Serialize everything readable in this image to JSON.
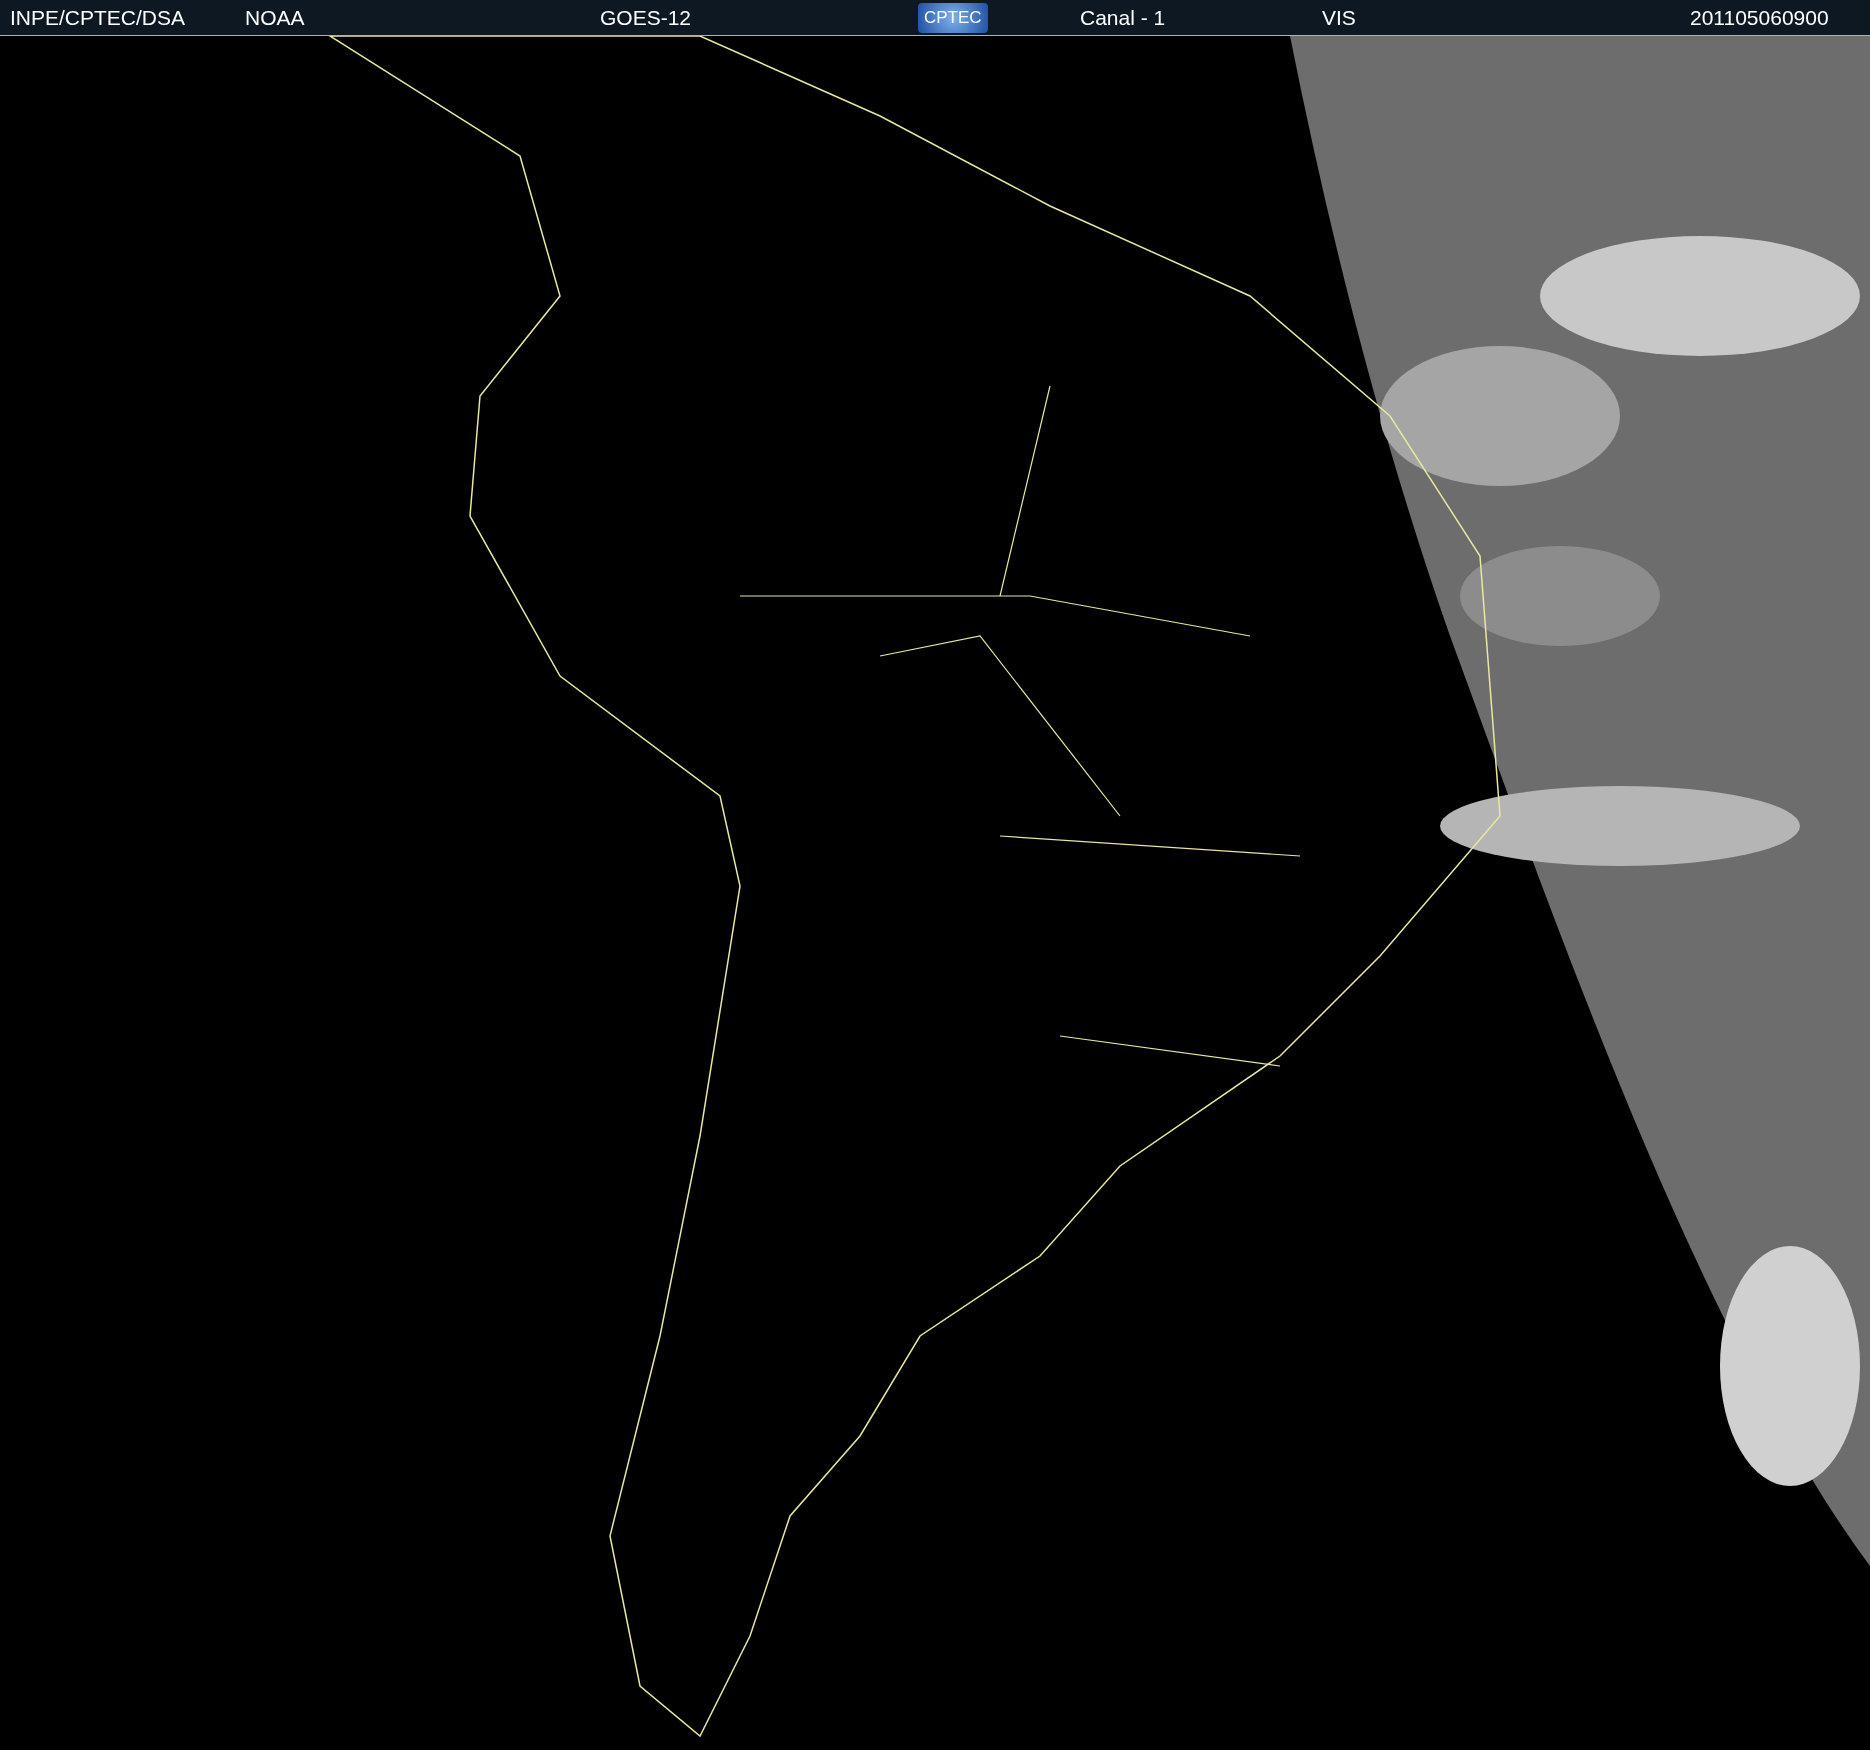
{
  "header": {
    "source": "INPE/CPTEC/DSA",
    "agency": "NOAA",
    "satellite": "GOES-12",
    "logo": "CPTEC",
    "channel": "Canal - 1",
    "band": "VIS",
    "timestamp": "201105060900"
  },
  "image": {
    "kind": "map-picture"
  }
}
